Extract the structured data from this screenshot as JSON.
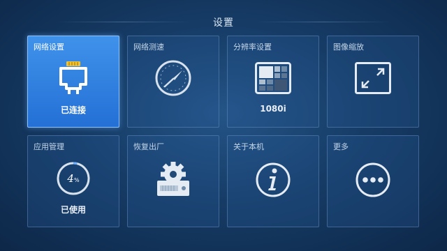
{
  "header": {
    "title": "设置"
  },
  "tiles": [
    {
      "label": "网络设置",
      "value": "已连接",
      "icon": "ethernet-icon",
      "active": true
    },
    {
      "label": "网络测速",
      "icon": "speedometer-icon"
    },
    {
      "label": "分辨率设置",
      "value": "1080i",
      "icon": "resolution-grid-icon"
    },
    {
      "label": "图像缩放",
      "icon": "scale-expand-icon"
    },
    {
      "label": "应用管理",
      "value": "已使用",
      "icon": "storage-gauge-icon",
      "usage_percent": 4,
      "usage_number": "4",
      "usage_unit": "%"
    },
    {
      "label": "恢复出厂",
      "icon": "factory-reset-gear-icon"
    },
    {
      "label": "关于本机",
      "icon": "info-icon"
    },
    {
      "label": "更多",
      "icon": "more-icon"
    }
  ],
  "colors": {
    "accent": "#2f80e0",
    "background": "#163c66",
    "tile_border": "#6e96c8"
  }
}
